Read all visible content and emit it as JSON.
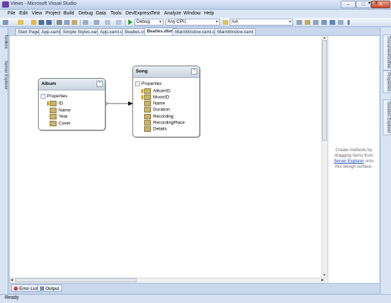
{
  "window": {
    "title": "Views - Microsoft Visual Studio",
    "buttons": {
      "minimize": "–",
      "maximize": "□",
      "close": "X"
    }
  },
  "menu": [
    "File",
    "Edit",
    "View",
    "Project",
    "Build",
    "Debug",
    "Data",
    "Tools",
    "DevExpress",
    "Test",
    "Analyze",
    "Window",
    "Help"
  ],
  "toolbar": {
    "config": "Debug",
    "platform": "Any CPU",
    "find": "run",
    "dropdown_arrow": "▼"
  },
  "left_rail": [
    "Toolbox",
    "Server Explorer"
  ],
  "right_rail": [
    "DocumentOutline",
    "Properties",
    "Solution Explorer"
  ],
  "doc_tabs": [
    {
      "label": "Start Page",
      "active": false
    },
    {
      "label": "App.xaml",
      "active": false
    },
    {
      "label": "Simple Styles.xaml",
      "active": false
    },
    {
      "label": "App.xaml.cs",
      "active": false
    },
    {
      "label": "Beatles.cs",
      "active": false
    },
    {
      "label": "Beatles.dbml",
      "active": true
    },
    {
      "label": "MainWindow.xaml.cs",
      "active": false
    },
    {
      "label": "MainWindow.xaml",
      "active": false
    }
  ],
  "tab_controls": {
    "pin": "▾",
    "close": "x"
  },
  "entities": {
    "album": {
      "title": "Album",
      "collapse": "^",
      "properties_label": "Properties",
      "properties": [
        "ID",
        "Name",
        "Year",
        "Cover"
      ],
      "key_props": [
        "ID"
      ]
    },
    "song": {
      "title": "Song",
      "collapse": "^",
      "properties_label": "Properties",
      "properties": [
        "AlbumID",
        "MusicID",
        "Name",
        "Duration",
        "Recording",
        "RecordingPlace",
        "Details"
      ],
      "key_props": [
        "AlbumID",
        "MusicID"
      ]
    }
  },
  "methods_pane": {
    "hint_before": "Create methods by dragging items from",
    "hint_link": "Server Explorer",
    "hint_after": "onto this design surface."
  },
  "bottom_tabs": [
    "Error List",
    "Output"
  ],
  "status": "Ready"
}
